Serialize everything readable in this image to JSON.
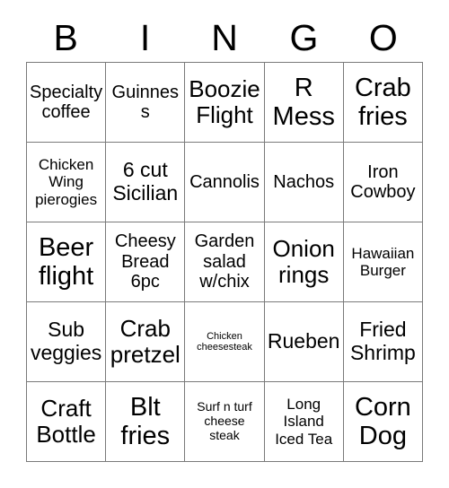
{
  "card": {
    "title": "BINGO",
    "header_letters": [
      "B",
      "I",
      "N",
      "G",
      "O"
    ],
    "columns": 5,
    "rows": 5,
    "border_color": "#7a7a7a",
    "text_color": "#000000",
    "background_color": "#ffffff",
    "rows_data": [
      [
        {
          "text": "Specialty coffee",
          "size": "md"
        },
        {
          "text": "Guinness",
          "size": "md"
        },
        {
          "text": "Boozie Flight",
          "size": "xl"
        },
        {
          "text": "R Mess",
          "size": "xxl"
        },
        {
          "text": "Crab fries",
          "size": "xxl"
        }
      ],
      [
        {
          "text": "Chicken Wing pierogies",
          "size": "sm"
        },
        {
          "text": "6 cut Sicilian",
          "size": "lg"
        },
        {
          "text": "Cannolis",
          "size": "md"
        },
        {
          "text": "Nachos",
          "size": "md"
        },
        {
          "text": "Iron Cowboy",
          "size": "md"
        }
      ],
      [
        {
          "text": "Beer flight",
          "size": "xxl"
        },
        {
          "text": "Cheesy Bread 6pc",
          "size": "md"
        },
        {
          "text": "Garden salad w/chix",
          "size": "md"
        },
        {
          "text": "Onion rings",
          "size": "xl"
        },
        {
          "text": "Hawaiian Burger",
          "size": "sm"
        }
      ],
      [
        {
          "text": "Sub veggies",
          "size": "lg"
        },
        {
          "text": "Crab pretzel",
          "size": "xl"
        },
        {
          "text": "Chicken cheesesteak",
          "size": "xxs"
        },
        {
          "text": "Rueben",
          "size": "lg"
        },
        {
          "text": "Fried Shrimp",
          "size": "lg"
        }
      ],
      [
        {
          "text": "Craft Bottle",
          "size": "xl"
        },
        {
          "text": "Blt fries",
          "size": "xxl"
        },
        {
          "text": "Surf n turf cheese steak",
          "size": "xs"
        },
        {
          "text": "Long Island Iced Tea",
          "size": "sm"
        },
        {
          "text": "Corn Dog",
          "size": "xxl"
        }
      ]
    ]
  }
}
